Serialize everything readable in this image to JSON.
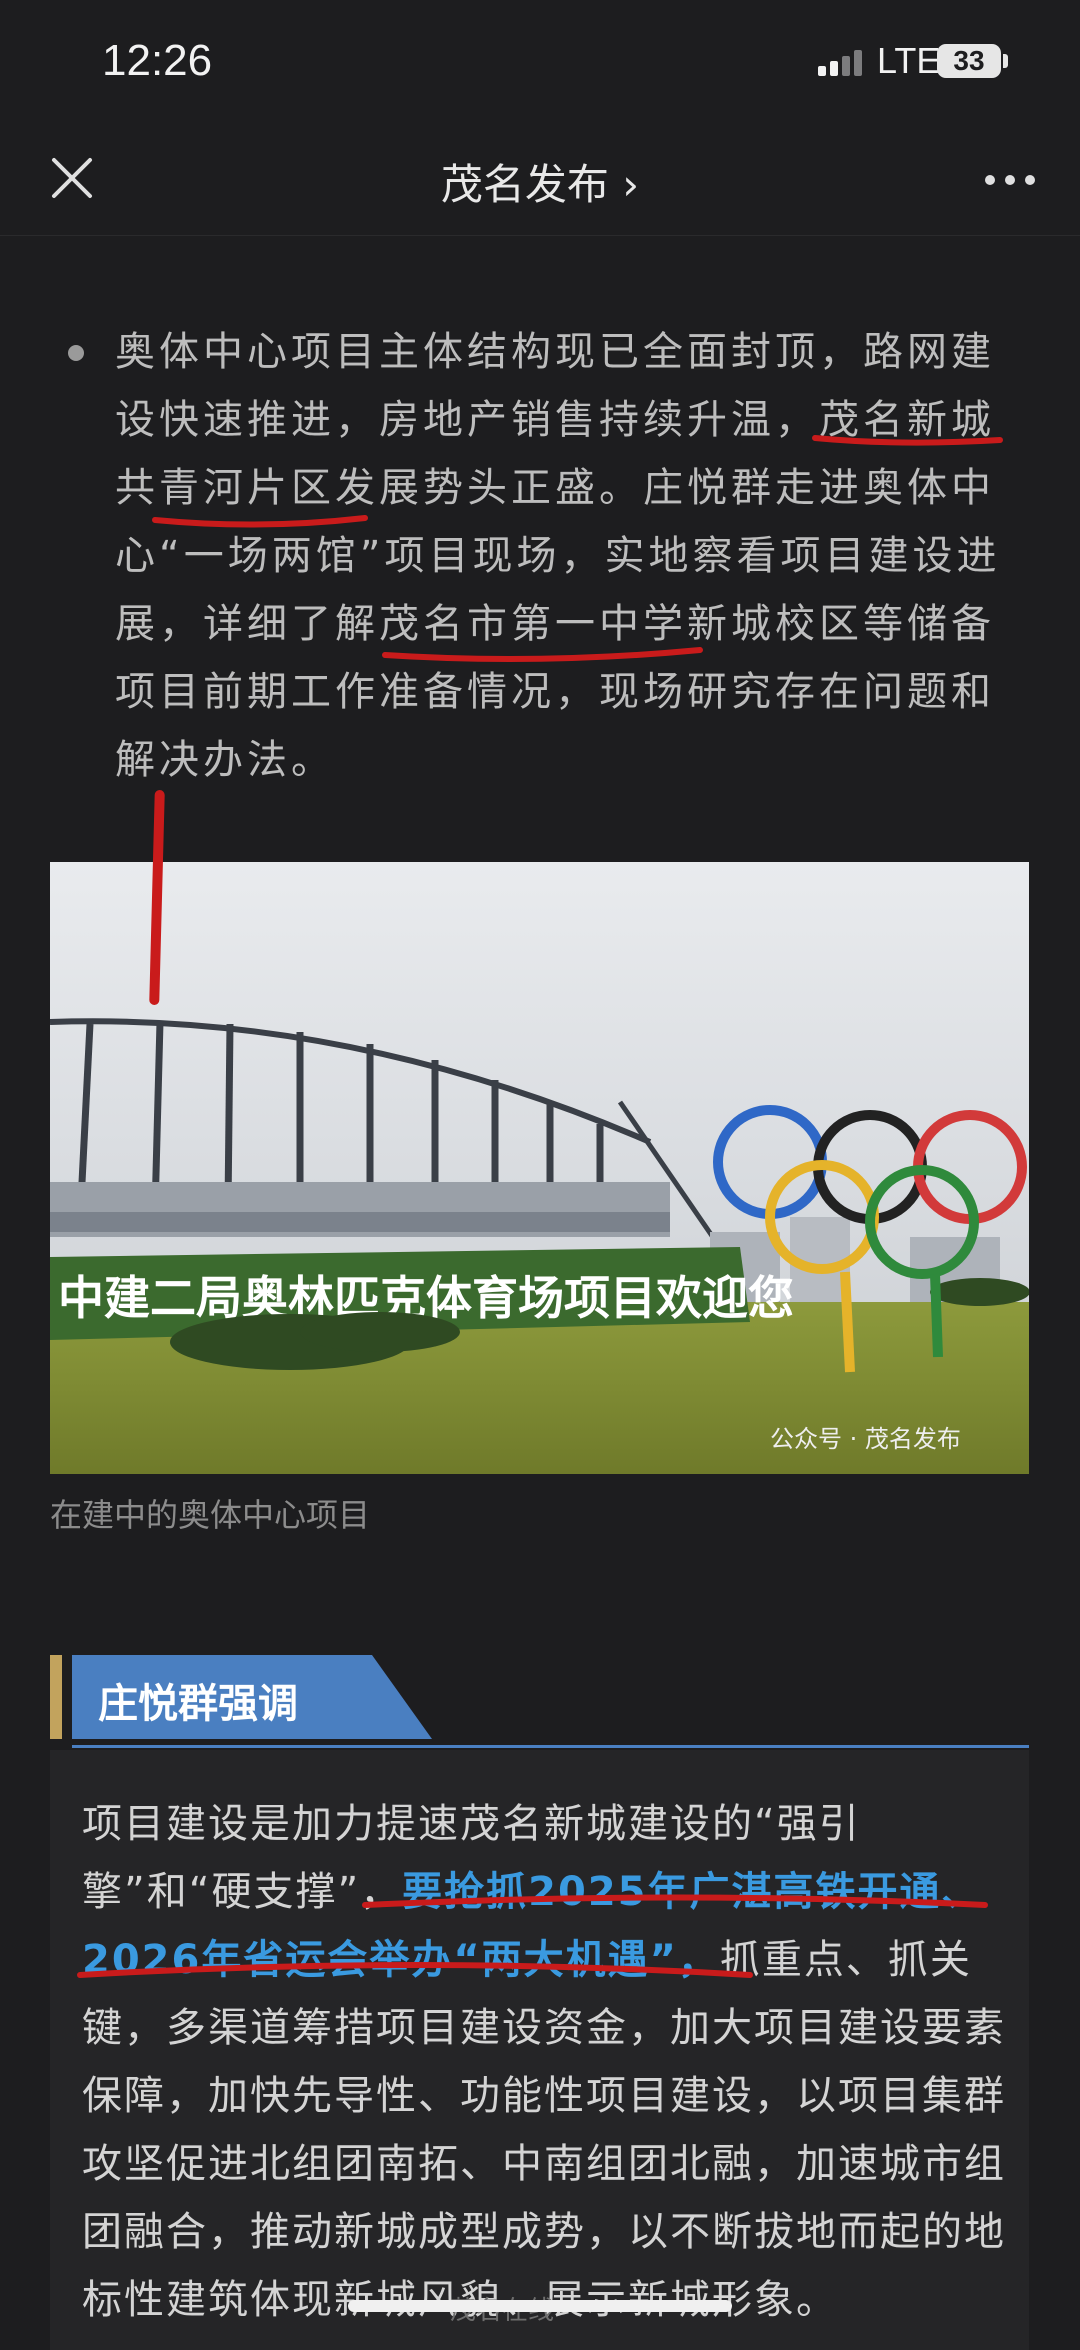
{
  "status_bar": {
    "time": "12:26",
    "network": "LTE",
    "battery": "33"
  },
  "nav": {
    "title": "茂名发布 ›"
  },
  "article": {
    "paragraph1": "奥体中心项目主体结构现已全面封顶，路网建设快速推进，房地产销售持续升温，茂名新城共青河片区发展势头正盛。庄悦群走进奥体中心“一场两馆”项目现场，实地察看项目建设进展，详细了解茂名市第一中学新城校区等储备项目前期工作准备情况，现场研究存在问题和解决办法。",
    "photo": {
      "banner_text": "中建二局奥林匹克体育场项目欢迎您",
      "watermark": "公众号 · 茂名发布"
    },
    "caption": "在建中的奥体中心项目",
    "section_title": "庄悦群强调",
    "paragraph2_part1": "项目建设是加力提速茂名新城建设的“强引擎”和“硬支撑”，",
    "paragraph2_highlight": "要抢抓2025年广湛高铁开通、2026年省运会举办“两大机遇”，",
    "paragraph2_part2": "抓重点、抓关键，多渠道筹措项目建设资金，加大项目建设要素保障，加快先导性、功能性项目建设，以项目集群攻坚促进北组团南拓、中南组团北融，加速城市组团融合，推动新城成型成势，以不断拔地而起的地标性建筑体现新城风貌、展示新城形象。"
  },
  "footer_watermark": "茂名在线"
}
